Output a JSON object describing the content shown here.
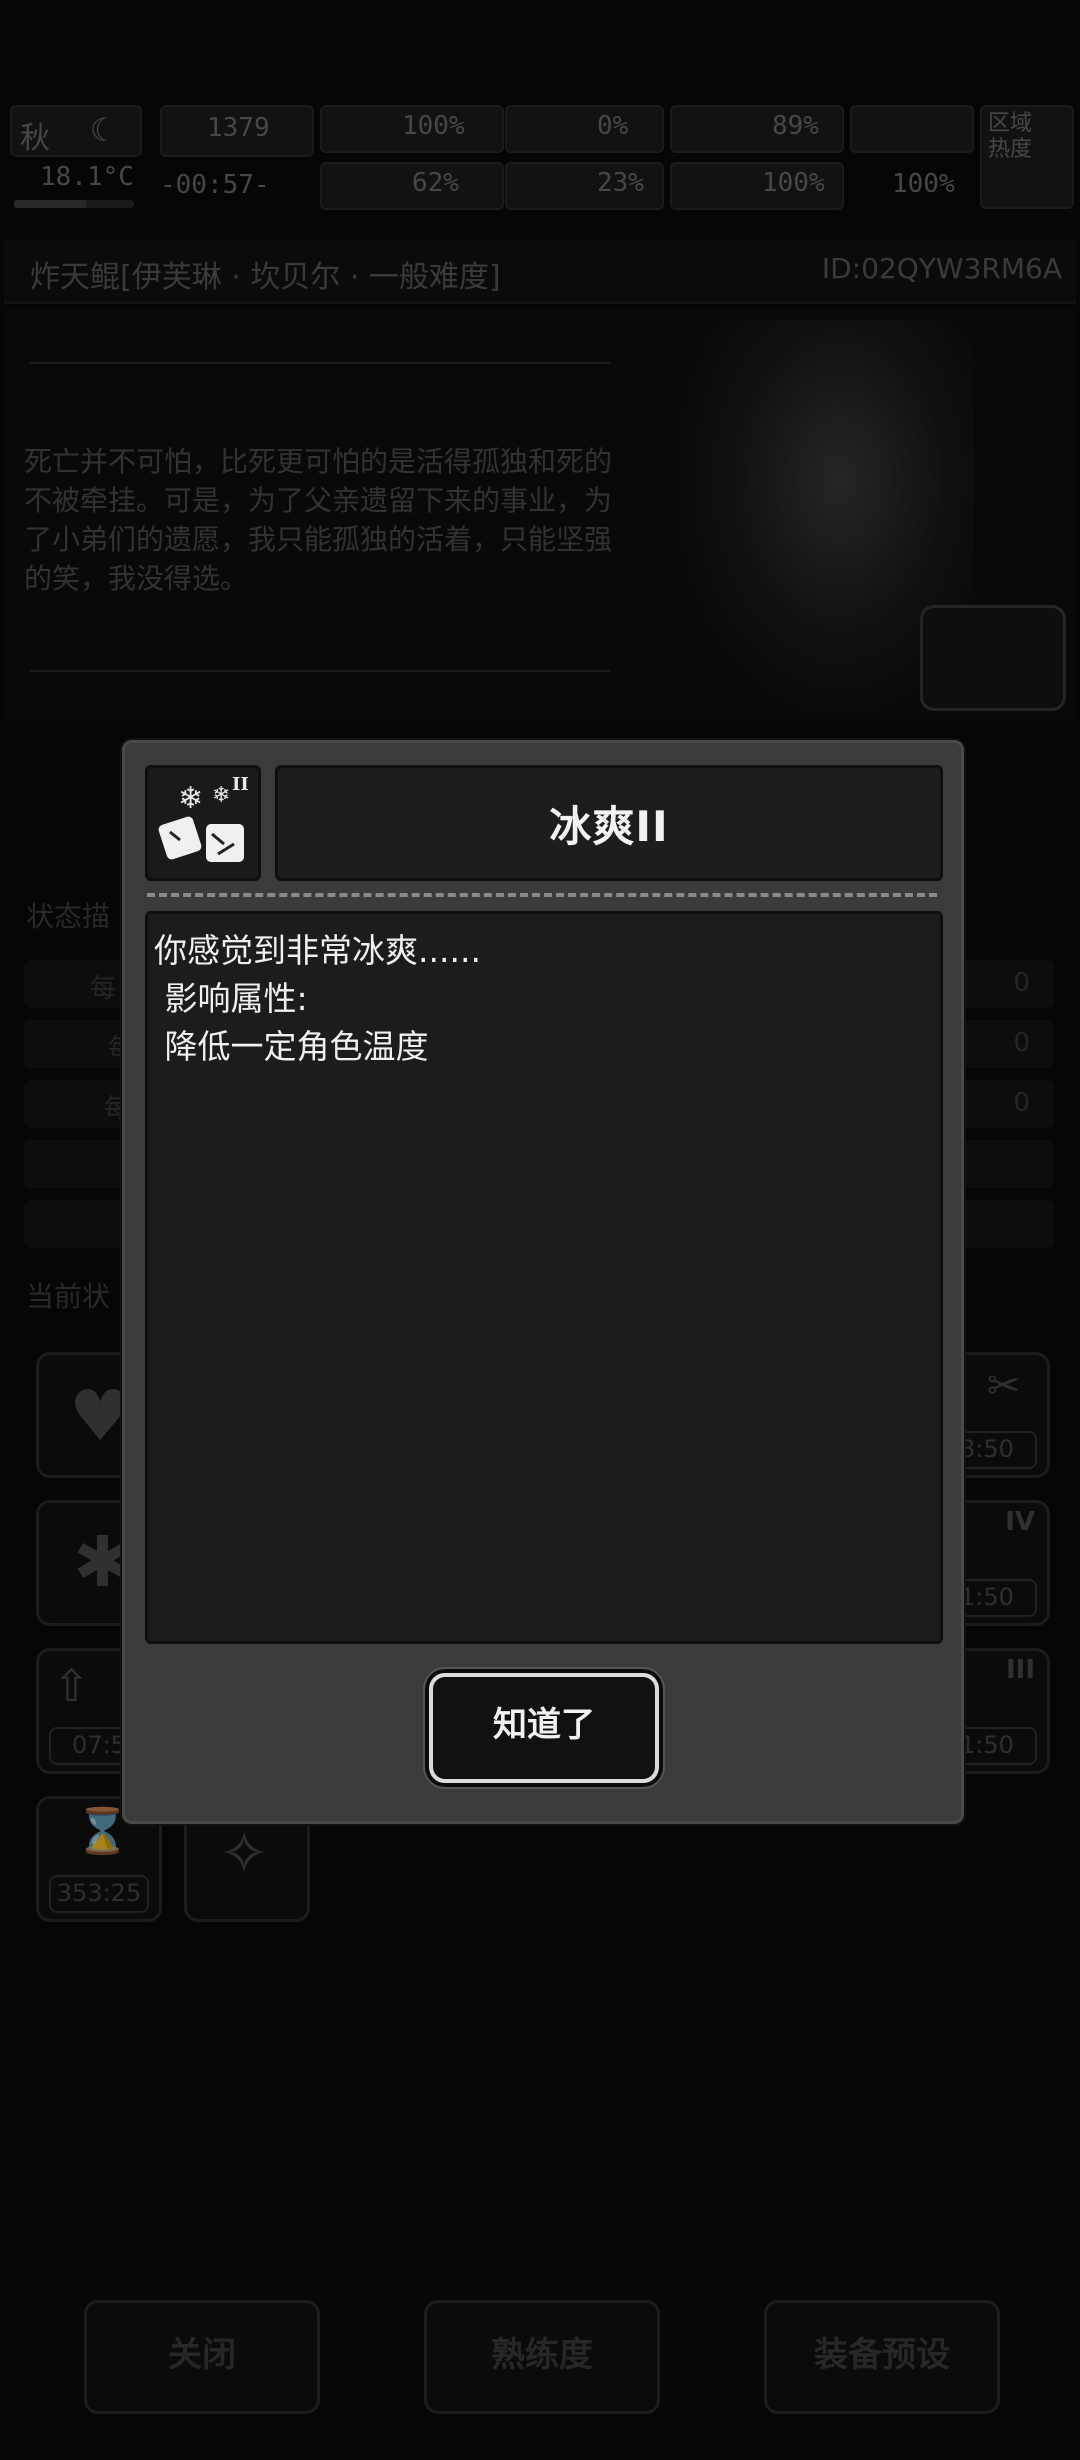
{
  "hud": {
    "season": "秋",
    "temperature": "18.1°C",
    "day_counter": "1379",
    "clock": "-00:57-",
    "stats": [
      {
        "name": "health",
        "value": "100%"
      },
      {
        "name": "hunger",
        "value": "0%"
      },
      {
        "name": "water",
        "value": "89%"
      },
      {
        "name": "stamina",
        "value": "100%"
      },
      {
        "name": "mood",
        "value": "62%"
      },
      {
        "name": "infection",
        "value": "23%"
      },
      {
        "name": "heart",
        "value": "100%"
      }
    ],
    "zone_heat_label": "区域\n热度"
  },
  "character": {
    "name": "炸天鲲[伊芙琳 · 坎贝尔 · 一般难度]",
    "id": "ID:02QYW3RM6A",
    "story": "死亡并不可怕，比死更可怕的是活得孤独和死的不被牵挂。可是，为了父亲遗留下来的事业，为了小弟们的遗愿，我只能孤独的活着，只能坚强的笑，我没得选。"
  },
  "status_section": {
    "title_partial": "状态描",
    "rows_left": [
      "每",
      "每",
      "每"
    ],
    "rows_right": [
      "0",
      "0",
      "0"
    ]
  },
  "current_section": {
    "title_partial": "当前状",
    "tiles": [
      {
        "icon": "heart-icon",
        "time": ""
      },
      {
        "icon": "figure-icon",
        "time": ""
      },
      {
        "icon": "arrow-up-icon",
        "time": "07:5"
      },
      {
        "icon": "hourglass-icon",
        "time": "353:25"
      },
      {
        "icon": "foot-icon",
        "time": ""
      },
      {
        "icon": "syringe-icon",
        "time": "3:50"
      },
      {
        "icon": "stretch-icon",
        "time": "1:50"
      },
      {
        "icon": "hand-icon",
        "time": "1:50"
      }
    ],
    "tile_roman": [
      "IV",
      "III"
    ]
  },
  "footer": {
    "close_label": "关闭",
    "proficiency_label": "熟练度",
    "preset_label": "装备预设"
  },
  "modal": {
    "title": "冰爽II",
    "icon": "ice-cube-icon",
    "icon_level": "II",
    "description_lines": [
      "你感觉到非常冰爽......",
      " 影响属性:",
      " 降低一定角色温度"
    ],
    "ok_label": "知道了"
  },
  "colors": {
    "modal_bg": "#3b3b3b",
    "panel_bg": "#1c1c1c",
    "text": "#f0f0f0",
    "dim_text": "#4e4e4e"
  }
}
